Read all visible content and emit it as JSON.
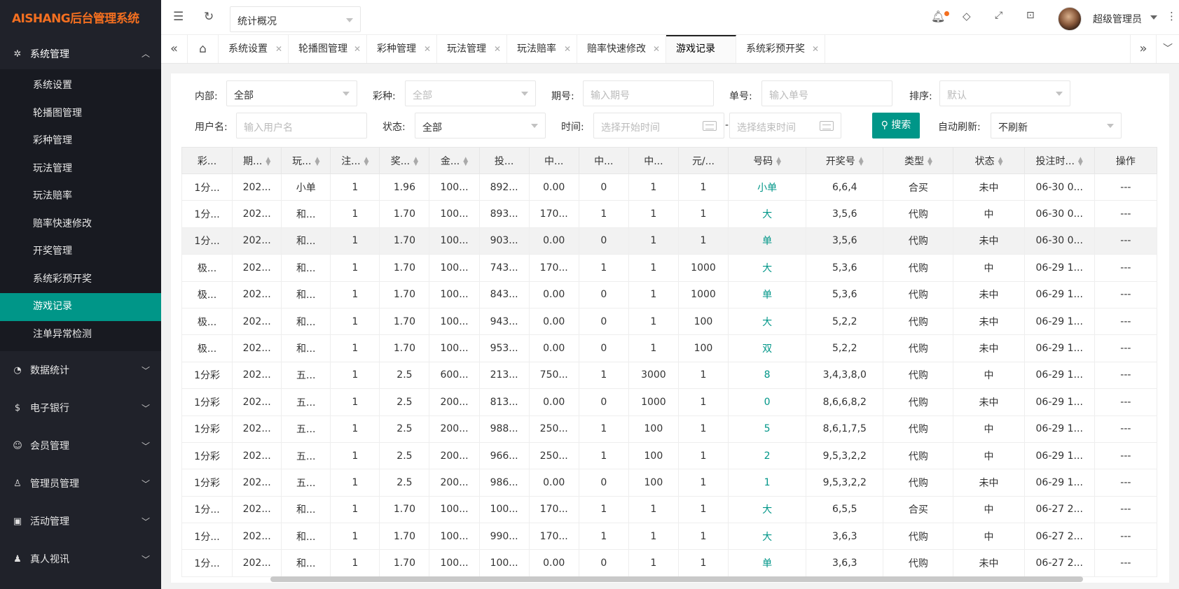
{
  "app": {
    "logo": "AISHANG后台管理系统"
  },
  "sidebar": {
    "group_system": "系统管理",
    "items": [
      {
        "label": "系统设置"
      },
      {
        "label": "轮播图管理"
      },
      {
        "label": "彩种管理"
      },
      {
        "label": "玩法管理"
      },
      {
        "label": "玩法赔率"
      },
      {
        "label": "赔率快速修改"
      },
      {
        "label": "开奖管理"
      },
      {
        "label": "系统彩预开奖"
      },
      {
        "label": "游戏记录"
      },
      {
        "label": "注单异常检测"
      }
    ],
    "groups": [
      {
        "label": "数据统计",
        "icon": "dashboard-icon"
      },
      {
        "label": "电子银行",
        "icon": "dollar-icon"
      },
      {
        "label": "会员管理",
        "icon": "user-icon"
      },
      {
        "label": "管理员管理",
        "icon": "user-icon"
      },
      {
        "label": "活动管理",
        "icon": "gift-icon"
      },
      {
        "label": "真人视讯",
        "icon": "users-icon"
      }
    ]
  },
  "header": {
    "select_value": "统计概况",
    "user": "超级管理员",
    "accent": "#009688",
    "notify_dot": "#f36f20"
  },
  "tabs": [
    {
      "label": "系统设置"
    },
    {
      "label": "轮播图管理"
    },
    {
      "label": "彩种管理"
    },
    {
      "label": "玩法管理"
    },
    {
      "label": "玩法赔率"
    },
    {
      "label": "赔率快速修改"
    },
    {
      "label": "游戏记录",
      "active": true
    },
    {
      "label": "系统彩预开奖"
    }
  ],
  "filters": {
    "internal_label": "内部:",
    "internal_value": "全部",
    "lottery_label": "彩种:",
    "lottery_placeholder": "全部",
    "period_label": "期号:",
    "period_placeholder": "输入期号",
    "order_label": "单号:",
    "order_placeholder": "输入单号",
    "sort_label": "排序:",
    "sort_placeholder": "默认",
    "user_label": "用户名:",
    "user_placeholder": "输入用户名",
    "status_label": "状态:",
    "status_value": "全部",
    "time_label": "时间:",
    "time_start_placeholder": "选择开始时间",
    "time_sep": "-",
    "time_end_placeholder": "选择结束时间",
    "search_label": "搜索",
    "refresh_label": "自动刷新:",
    "refresh_value": "不刷新"
  },
  "table": {
    "headers": [
      "彩...",
      "期...",
      "玩...",
      "注...",
      "奖...",
      "金...",
      "投...",
      "中...",
      "中...",
      "中...",
      "元/...",
      "号码",
      "开奖号",
      "类型",
      "状态",
      "投注时...",
      "操作"
    ],
    "rows": [
      [
        "1分...",
        "202...",
        "小单",
        "1",
        "1.96",
        "100...",
        "892...",
        "0.00",
        "0",
        "1",
        "1",
        "小单",
        "6,6,4",
        "合买",
        "未中",
        "06-30 0...",
        "---"
      ],
      [
        "1分...",
        "202...",
        "和...",
        "1",
        "1.70",
        "100...",
        "893...",
        "170...",
        "1",
        "1",
        "1",
        "大",
        "3,5,6",
        "代购",
        "中",
        "06-30 0...",
        "---"
      ],
      [
        "1分...",
        "202...",
        "和...",
        "1",
        "1.70",
        "100...",
        "903...",
        "0.00",
        "0",
        "1",
        "1",
        "单",
        "3,5,6",
        "代购",
        "未中",
        "06-30 0...",
        "---"
      ],
      [
        "极...",
        "202...",
        "和...",
        "1",
        "1.70",
        "100...",
        "743...",
        "170...",
        "1",
        "1",
        "1000",
        "大",
        "5,3,6",
        "代购",
        "中",
        "06-29 1...",
        "---"
      ],
      [
        "极...",
        "202...",
        "和...",
        "1",
        "1.70",
        "100...",
        "843...",
        "0.00",
        "0",
        "1",
        "1000",
        "单",
        "5,3,6",
        "代购",
        "未中",
        "06-29 1...",
        "---"
      ],
      [
        "极...",
        "202...",
        "和...",
        "1",
        "1.70",
        "100...",
        "943...",
        "0.00",
        "0",
        "1",
        "100",
        "大",
        "5,2,2",
        "代购",
        "未中",
        "06-29 1...",
        "---"
      ],
      [
        "极...",
        "202...",
        "和...",
        "1",
        "1.70",
        "100...",
        "953...",
        "0.00",
        "0",
        "1",
        "100",
        "双",
        "5,2,2",
        "代购",
        "未中",
        "06-29 1...",
        "---"
      ],
      [
        "1分彩",
        "202...",
        "五...",
        "1",
        "2.5",
        "600...",
        "213...",
        "750...",
        "1",
        "3000",
        "1",
        "8",
        "3,4,3,8,0",
        "代购",
        "中",
        "06-29 1...",
        "---"
      ],
      [
        "1分彩",
        "202...",
        "五...",
        "1",
        "2.5",
        "200...",
        "813...",
        "0.00",
        "0",
        "1000",
        "1",
        "0",
        "8,6,6,8,2",
        "代购",
        "未中",
        "06-29 1...",
        "---"
      ],
      [
        "1分彩",
        "202...",
        "五...",
        "1",
        "2.5",
        "200...",
        "988...",
        "250...",
        "1",
        "100",
        "1",
        "5",
        "8,6,1,7,5",
        "代购",
        "中",
        "06-29 1...",
        "---"
      ],
      [
        "1分彩",
        "202...",
        "五...",
        "1",
        "2.5",
        "200...",
        "966...",
        "250...",
        "1",
        "100",
        "1",
        "2",
        "9,5,3,2,2",
        "代购",
        "中",
        "06-29 1...",
        "---"
      ],
      [
        "1分彩",
        "202...",
        "五...",
        "1",
        "2.5",
        "200...",
        "986...",
        "0.00",
        "0",
        "100",
        "1",
        "1",
        "9,5,3,2,2",
        "代购",
        "未中",
        "06-29 1...",
        "---"
      ],
      [
        "1分...",
        "202...",
        "和...",
        "1",
        "1.70",
        "100...",
        "100...",
        "170...",
        "1",
        "1",
        "1",
        "大",
        "6,5,5",
        "合买",
        "中",
        "06-27 2...",
        "---"
      ],
      [
        "1分...",
        "202...",
        "和...",
        "1",
        "1.70",
        "100...",
        "990...",
        "170...",
        "1",
        "1",
        "1",
        "大",
        "3,6,3",
        "代购",
        "中",
        "06-27 2...",
        "---"
      ],
      [
        "1分...",
        "202...",
        "和...",
        "1",
        "1.70",
        "100...",
        "100...",
        "0.00",
        "0",
        "1",
        "1",
        "单",
        "3,6,3",
        "代购",
        "未中",
        "06-27 2...",
        "---"
      ]
    ]
  }
}
